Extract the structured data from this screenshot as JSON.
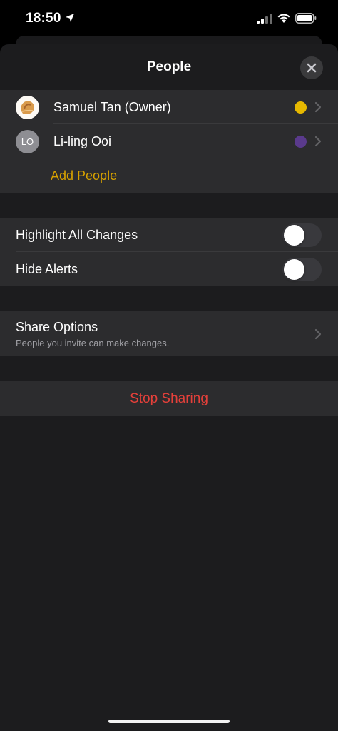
{
  "status_bar": {
    "time": "18:50",
    "icons": [
      "location-arrow-icon",
      "signal-icon",
      "wifi-icon",
      "battery-icon"
    ]
  },
  "nav": {
    "title": "People",
    "close_icon": "close-icon"
  },
  "people": [
    {
      "name": "Samuel Tan (Owner)",
      "avatar_type": "photo",
      "initials": "",
      "color": "#e6b800"
    },
    {
      "name": "Li-ling Ooi",
      "avatar_type": "initials",
      "initials": "LO",
      "color": "#5a3a8c"
    }
  ],
  "add_people_label": "Add People",
  "toggles": [
    {
      "label": "Highlight All Changes",
      "on": false
    },
    {
      "label": "Hide Alerts",
      "on": false
    }
  ],
  "share_options": {
    "title": "Share Options",
    "subtitle": "People you invite can make changes."
  },
  "stop_sharing_label": "Stop Sharing",
  "colors": {
    "accent_add": "#d6a100",
    "destructive": "#e5403a",
    "sheet_bg": "#1c1c1e",
    "cell_bg": "#2c2c2e"
  }
}
